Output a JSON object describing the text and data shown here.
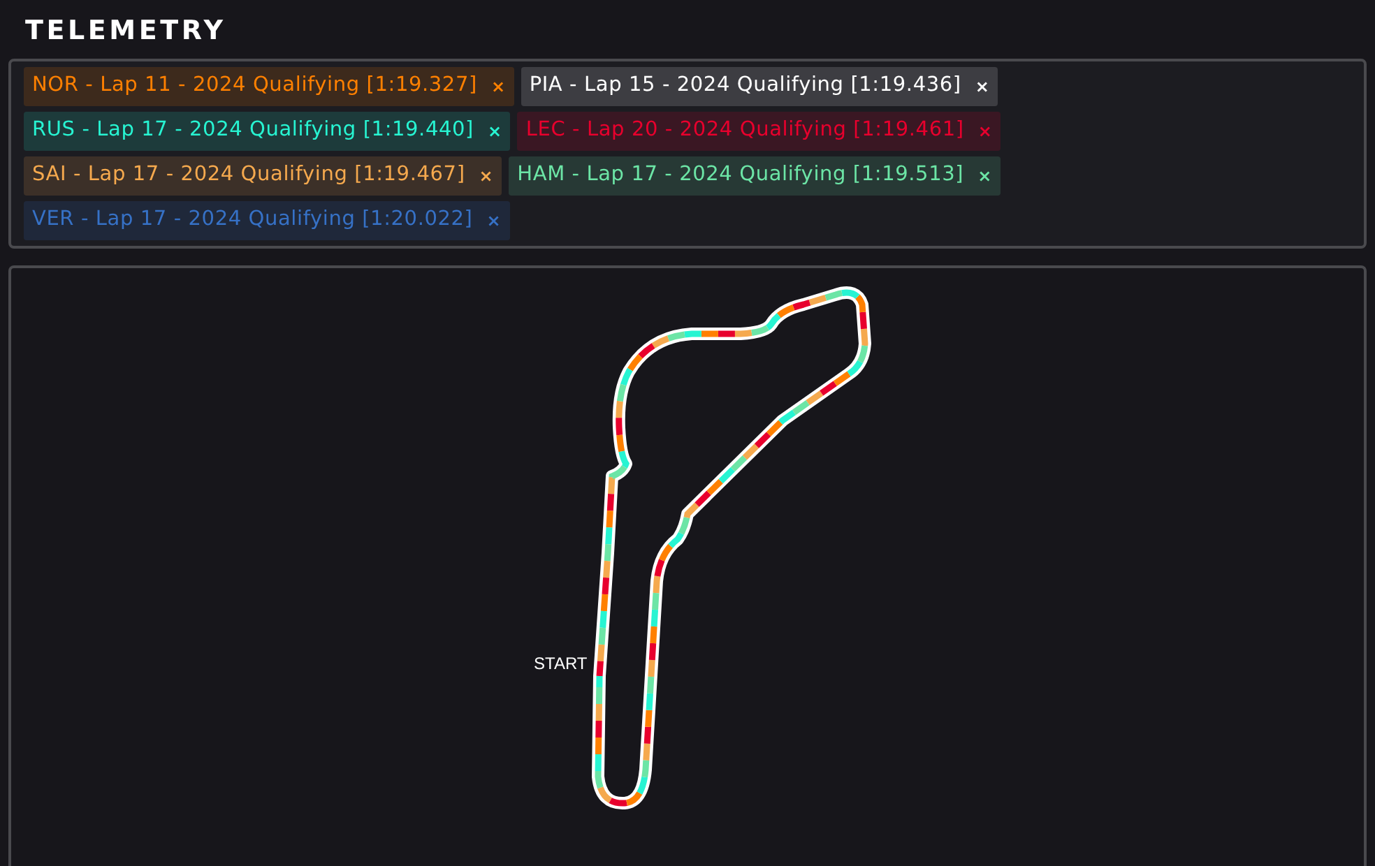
{
  "title": "TELEMETRY",
  "laps": [
    {
      "label": "NOR - Lap 11 - 2024 Qualifying [1:19.327]",
      "remove": "×",
      "color": "#ff8000"
    },
    {
      "label": "PIA - Lap 15 - 2024 Qualifying [1:19.436]",
      "remove": "×",
      "color": "#ffffff"
    },
    {
      "label": "RUS - Lap 17 - 2024 Qualifying [1:19.440]",
      "remove": "×",
      "color": "#27f4d2"
    },
    {
      "label": "LEC - Lap 20 - 2024 Qualifying [1:19.461]",
      "remove": "×",
      "color": "#e8002d"
    },
    {
      "label": "SAI - Lap 17 - 2024 Qualifying [1:19.467]",
      "remove": "×",
      "color": "#f5a94e"
    },
    {
      "label": "HAM - Lap 17 - 2024 Qualifying [1:19.513]",
      "remove": "×",
      "color": "#6ce5a6"
    },
    {
      "label": "VER - Lap 17 - 2024 Qualifying [1:20.022]",
      "remove": "×",
      "color": "#3671c6"
    }
  ],
  "track": {
    "start_label": "START"
  }
}
